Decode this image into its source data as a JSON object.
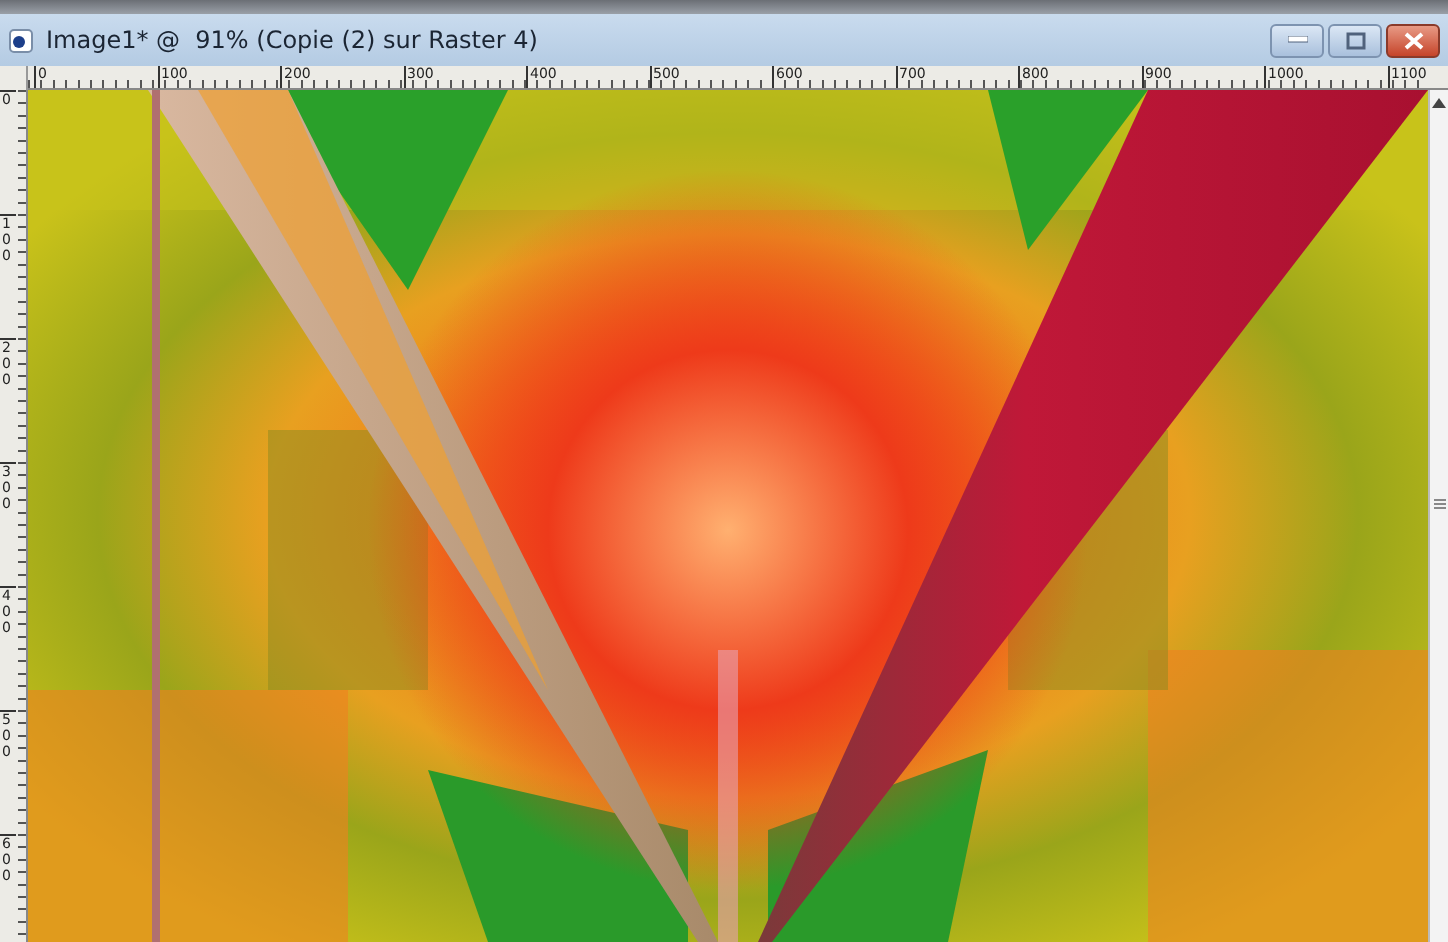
{
  "window": {
    "title": "Image1* @  91% (Copie (2) sur Raster 4)"
  },
  "horizontal_ruler": {
    "labels": [
      "0",
      "100",
      "200",
      "300",
      "400",
      "500",
      "600",
      "700",
      "800",
      "900",
      "1000",
      "1100"
    ]
  },
  "vertical_ruler": {
    "labels": [
      "0",
      "100",
      "200",
      "300",
      "400",
      "500",
      "600"
    ]
  }
}
